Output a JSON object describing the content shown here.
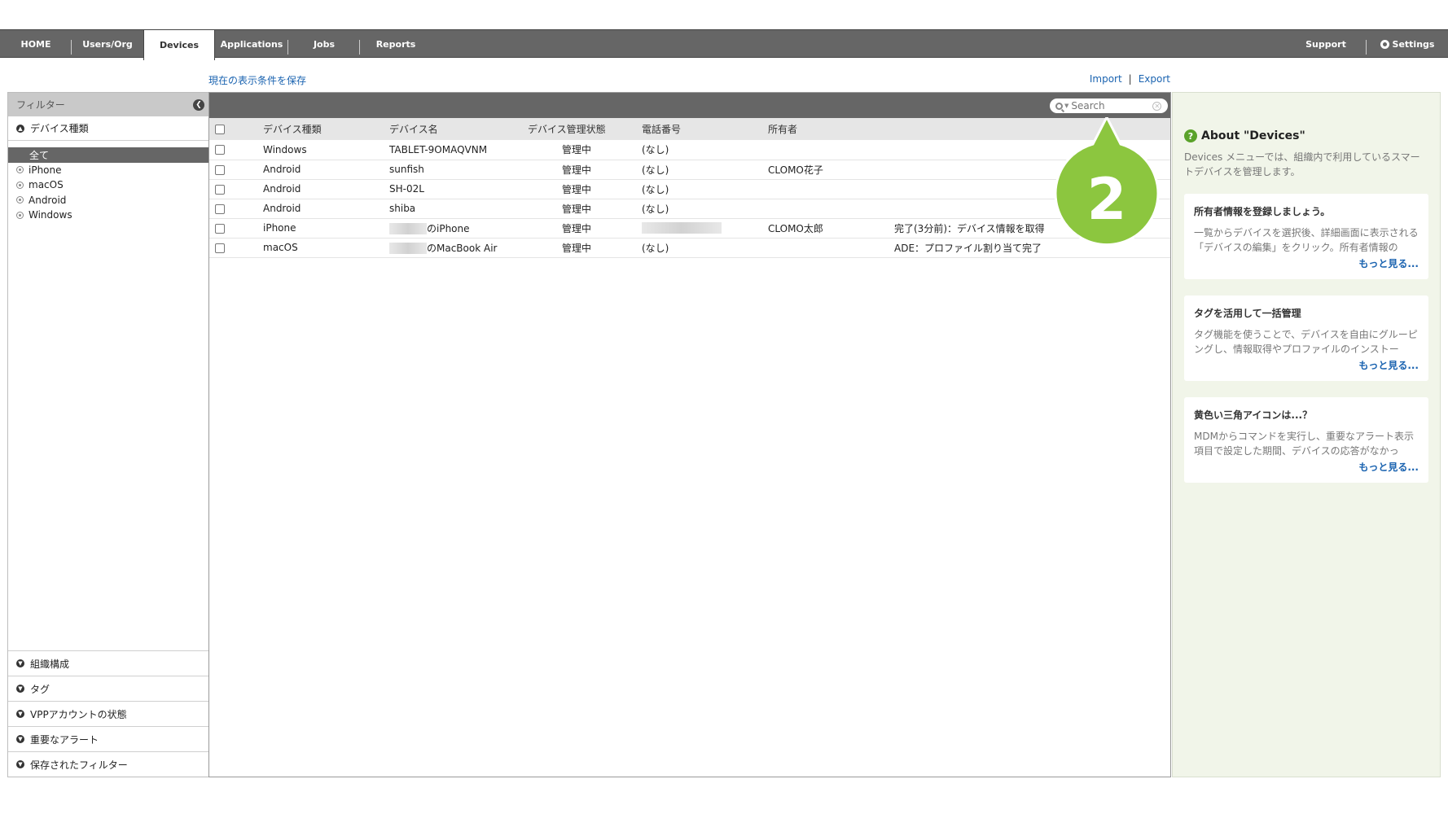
{
  "nav": {
    "left": [
      "HOME",
      "Users/Org",
      "Devices",
      "Applications",
      "Jobs",
      "Reports"
    ],
    "active": "Devices",
    "support": "Support",
    "settings": "Settings"
  },
  "actions": {
    "save_view": "現在の表示条件を保存",
    "import": "Import",
    "separator": "|",
    "export": "Export"
  },
  "filter": {
    "header": "フィルター",
    "device_type_section": "デバイス種類",
    "items": [
      "全て",
      "iPhone",
      "macOS",
      "Android",
      "Windows"
    ],
    "bottom_sections": [
      "組織構成",
      "タグ",
      "VPPアカウントの状態",
      "重要なアラート",
      "保存されたフィルター"
    ]
  },
  "search": {
    "placeholder": "Search"
  },
  "table": {
    "headers": [
      "デバイス種類",
      "デバイス名",
      "デバイス管理状態",
      "電話番号",
      "所有者"
    ],
    "rows": [
      {
        "type": "Windows",
        "name": "TABLET-9OMAQVNM",
        "status": "管理中",
        "phone": "(なし)",
        "owner": "",
        "job": ""
      },
      {
        "type": "Android",
        "name": "sunfish",
        "status": "管理中",
        "phone": "(なし)",
        "owner": "CLOMO花子",
        "job": ""
      },
      {
        "type": "Android",
        "name": "SH-02L",
        "status": "管理中",
        "phone": "(なし)",
        "owner": "",
        "job": ""
      },
      {
        "type": "Android",
        "name": "shiba",
        "status": "管理中",
        "phone": "(なし)",
        "owner": "",
        "job": ""
      },
      {
        "type": "iPhone",
        "name": "のiPhone",
        "status": "管理中",
        "phone": "",
        "owner": "CLOMO太郎",
        "job": "完了(3分前)：デバイス情報を取得"
      },
      {
        "type": "macOS",
        "name": "のMacBook Air",
        "status": "管理中",
        "phone": "(なし)",
        "owner": "",
        "job": "ADE：プロファイル割り当て完了"
      }
    ]
  },
  "help": {
    "title": "About \"Devices\"",
    "description": "Devices メニューでは、組織内で利用しているスマートデバイスを管理します。",
    "cards": [
      {
        "title": "所有者情報を登録しましょう。",
        "body": "一覧からデバイスを選択後、詳細画面に表示される「デバイスの編集」をクリック。所有者情報の",
        "more": "もっと見る..."
      },
      {
        "title": "タグを活用して一括管理",
        "body": "タグ機能を使うことで、デバイスを自由にグルーピングし、情報取得やプロファイルのインストー",
        "more": "もっと見る..."
      },
      {
        "title": "黄色い三角アイコンは...？",
        "body": "MDMからコマンドを実行し、重要なアラート表示項目で設定した期間、デバイスの応答がなかっ",
        "more": "もっと見る..."
      }
    ]
  },
  "callout": {
    "number": "2",
    "color": "#8cc63f"
  }
}
